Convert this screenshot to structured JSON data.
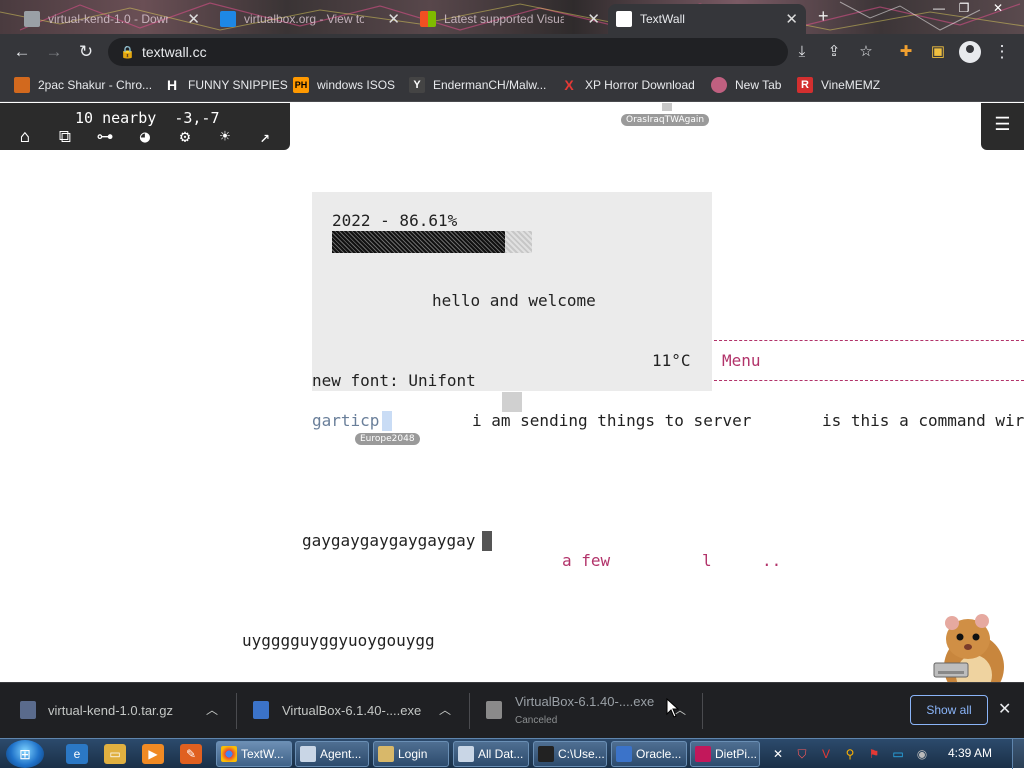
{
  "tabs": [
    {
      "title": "virtual-kend-1.0 - Down",
      "favicon": "#9aa0a6"
    },
    {
      "title": "virtualbox.org - View to",
      "favicon": "#1e88e5"
    },
    {
      "title": "Latest supported Visual",
      "favicon": "#f25022"
    },
    {
      "title": "TextWall",
      "favicon": "#ffffff"
    }
  ],
  "address_bar": {
    "url": "textwall.cc"
  },
  "bookmarks": [
    {
      "label": "2pac Shakur - Chro...",
      "icon": "image-icon",
      "icon_text": "",
      "color": "#d2691e"
    },
    {
      "label": "FUNNY SNIPPIES",
      "icon": "h-icon",
      "icon_text": "H",
      "color": "#ffffff"
    },
    {
      "label": "windows ISOS",
      "icon": "ph-icon",
      "icon_text": "PH",
      "color": "#ff9900"
    },
    {
      "label": "EndermanCH/Malw...",
      "icon": "yp-icon",
      "icon_text": "Y",
      "color": "#444444"
    },
    {
      "label": "XP Horror Download",
      "icon": "x-icon",
      "icon_text": "X",
      "color": "#e53935"
    },
    {
      "label": "New Tab",
      "icon": "newtab-icon",
      "icon_text": "",
      "color": "#c06080"
    },
    {
      "label": "VineMEMZ",
      "icon": "r-icon",
      "icon_text": "R",
      "color": "#d32f2f"
    }
  ],
  "textwall": {
    "status": "10 nearby  -3,-7",
    "cursors": [
      "OrasIraqTWAgain",
      "Europe2048"
    ],
    "texts": {
      "year_progress": "2022 - 86.61%",
      "welcome": "hello and welcome",
      "temperature": "11°C",
      "menu": "Menu",
      "new_font": "new font: Unifont",
      "garticp": "garticp",
      "sending": "i am sending things to server",
      "command": "is this a command wir",
      "gay": "gaygaygaygaygaygay",
      "few": "a few",
      "l": "l",
      "dots": "..",
      "uygg": "uygggguyggyuoygouygg"
    },
    "year_progress_value": 0.8661
  },
  "downloads": [
    {
      "name": "virtual-kend-1.0.tar.gz",
      "status": ""
    },
    {
      "name": "VirtualBox-6.1.40-....exe",
      "status": ""
    },
    {
      "name": "VirtualBox-6.1.40-....exe",
      "status": "Canceled"
    }
  ],
  "download_shelf": {
    "show_all": "Show all"
  },
  "taskbar": {
    "tasks": [
      "TextW...",
      "Agent...",
      "Login",
      "All Dat...",
      "C:\\Use...",
      "Oracle...",
      "DietPi..."
    ],
    "clock": "4:39 AM"
  }
}
